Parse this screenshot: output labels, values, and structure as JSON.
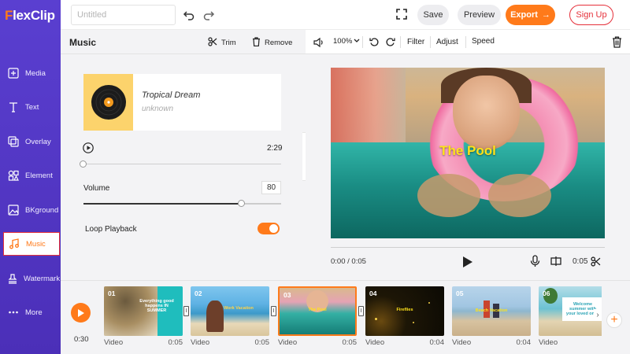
{
  "app": {
    "logo_f": "F",
    "logo_rest": "lexClip"
  },
  "header": {
    "title_placeholder": "Untitled",
    "save_label": "Save",
    "preview_label": "Preview",
    "export_label": "Export",
    "signup_label": "Sign Up"
  },
  "sidebar": {
    "items": [
      {
        "label": "Media",
        "icon": "media-icon"
      },
      {
        "label": "Text",
        "icon": "text-icon"
      },
      {
        "label": "Overlay",
        "icon": "overlay-icon"
      },
      {
        "label": "Element",
        "icon": "element-icon"
      },
      {
        "label": "BKground",
        "icon": "background-icon"
      },
      {
        "label": "Music",
        "icon": "music-note-icon",
        "active": true
      },
      {
        "label": "Watermark",
        "icon": "watermark-icon"
      },
      {
        "label": "More",
        "icon": "more-icon"
      }
    ]
  },
  "music_panel": {
    "title": "Music",
    "trim_label": "Trim",
    "remove_label": "Remove",
    "track_name": "Tropical Dream",
    "artist": "unknown",
    "duration": "2:29",
    "volume_label": "Volume",
    "volume_value": "80",
    "volume_level": 0.8,
    "loop_label": "Loop Playback",
    "loop_enabled": true,
    "cover_color": "#fcd36c"
  },
  "preview": {
    "zoom": "100%",
    "filter_label": "Filter",
    "adjust_label": "Adjust",
    "speed_label": "Speed",
    "video_title": "The Pool",
    "time_current": "0:00 / 0:05",
    "time_total": "0:05"
  },
  "timeline": {
    "total_duration": "0:30",
    "clips": [
      {
        "num": "01",
        "type": "Video",
        "duration": "0:05",
        "overlay": "Everything good happens IN SUMMER"
      },
      {
        "num": "02",
        "type": "Video",
        "duration": "0:05",
        "overlay": "Work Vacation"
      },
      {
        "num": "03",
        "type": "Video",
        "duration": "0:05",
        "overlay": "The Pool",
        "active": true
      },
      {
        "num": "04",
        "type": "Video",
        "duration": "0:04",
        "overlay": "Fireflies"
      },
      {
        "num": "05",
        "type": "Video",
        "duration": "0:04",
        "overlay": "Beach Vacation"
      },
      {
        "num": "06",
        "type": "Video",
        "duration": "",
        "overlay": "Welcome summer with your loved ones"
      }
    ]
  },
  "colors": {
    "accent": "#ff7a1a",
    "sidebar": "#5a3fd0",
    "danger": "#e5303a",
    "title_yellow": "#ffe21a"
  }
}
